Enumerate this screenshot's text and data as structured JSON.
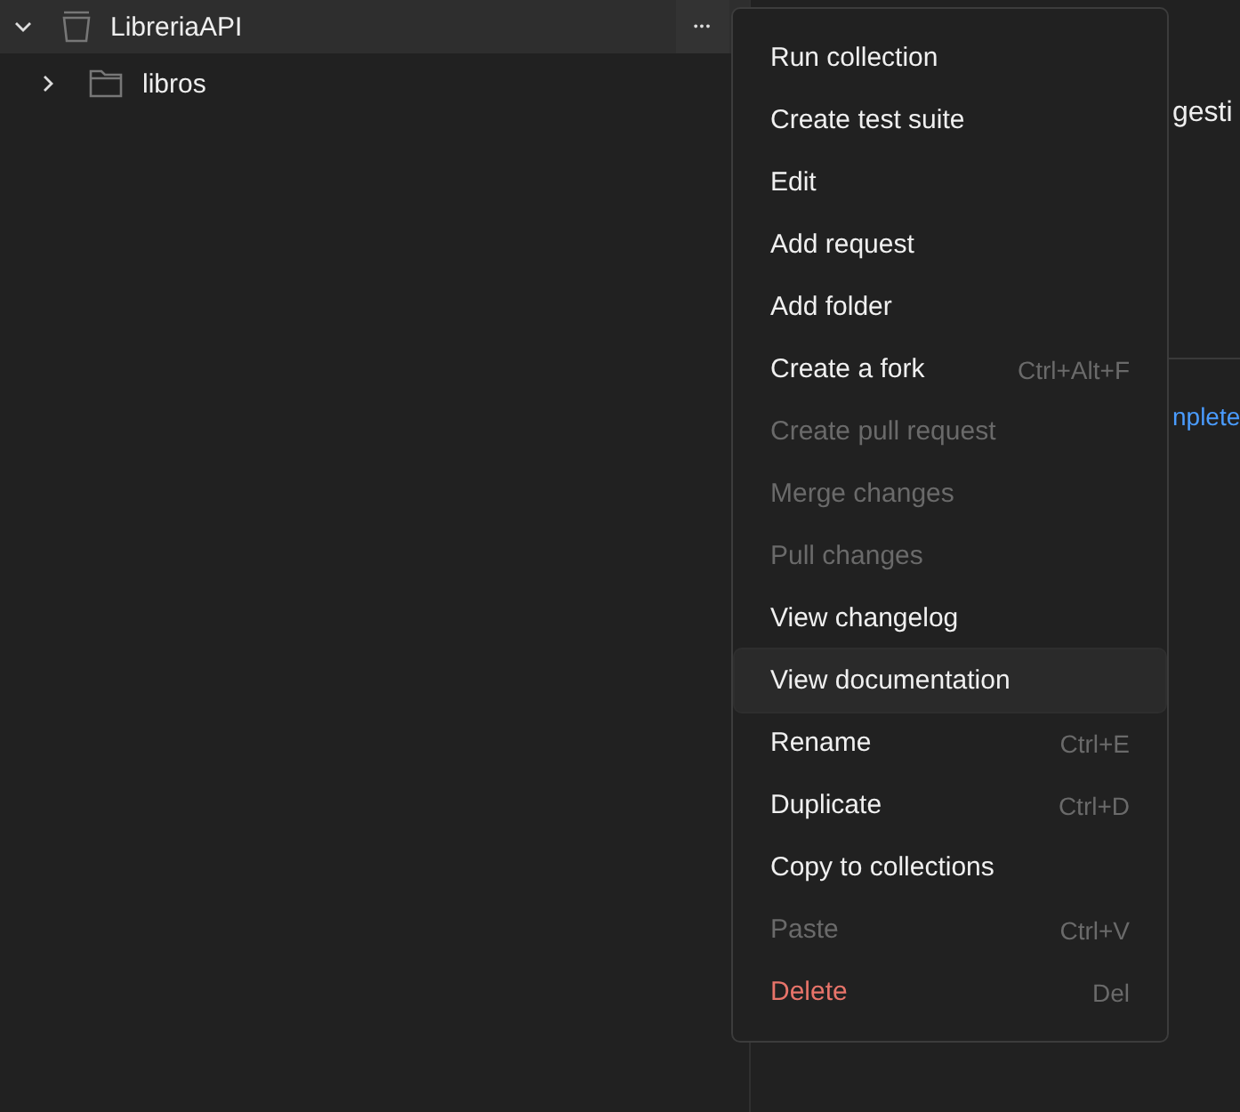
{
  "sidebar": {
    "collection": {
      "name": "LibreriaAPI",
      "expanded": true,
      "selected": true,
      "more_button": "•••"
    },
    "items": [
      {
        "name": "libros",
        "expanded": false
      }
    ]
  },
  "main": {
    "description_fragment": "gesti",
    "link_fragment": "nplete"
  },
  "context_menu": {
    "items": [
      {
        "label": "Run collection",
        "disabled": false,
        "kind": "normal",
        "highlighted": false
      },
      {
        "label": "Create test suite",
        "disabled": false,
        "kind": "normal",
        "highlighted": false
      },
      {
        "label": "Edit",
        "disabled": false,
        "kind": "normal",
        "highlighted": false
      },
      {
        "label": "Add request",
        "disabled": false,
        "kind": "normal",
        "highlighted": false
      },
      {
        "label": "Add folder",
        "disabled": false,
        "kind": "normal",
        "highlighted": false
      },
      {
        "label": "Create a fork",
        "shortcut": "Ctrl+Alt+F",
        "disabled": false,
        "kind": "normal",
        "highlighted": false
      },
      {
        "label": "Create pull request",
        "disabled": true,
        "kind": "normal",
        "highlighted": false
      },
      {
        "label": "Merge changes",
        "disabled": true,
        "kind": "normal",
        "highlighted": false
      },
      {
        "label": "Pull changes",
        "disabled": true,
        "kind": "normal",
        "highlighted": false
      },
      {
        "label": "View changelog",
        "disabled": false,
        "kind": "normal",
        "highlighted": false
      },
      {
        "label": "View documentation",
        "disabled": false,
        "kind": "normal",
        "highlighted": true
      },
      {
        "label": "Rename",
        "shortcut": "Ctrl+E",
        "disabled": false,
        "kind": "normal",
        "highlighted": false
      },
      {
        "label": "Duplicate",
        "shortcut": "Ctrl+D",
        "disabled": false,
        "kind": "normal",
        "highlighted": false
      },
      {
        "label": "Copy to collections",
        "disabled": false,
        "kind": "normal",
        "highlighted": false
      },
      {
        "label": "Paste",
        "shortcut": "Ctrl+V",
        "disabled": true,
        "kind": "normal",
        "highlighted": false
      },
      {
        "label": "Delete",
        "shortcut": "Del",
        "disabled": false,
        "kind": "danger",
        "highlighted": false
      }
    ]
  }
}
